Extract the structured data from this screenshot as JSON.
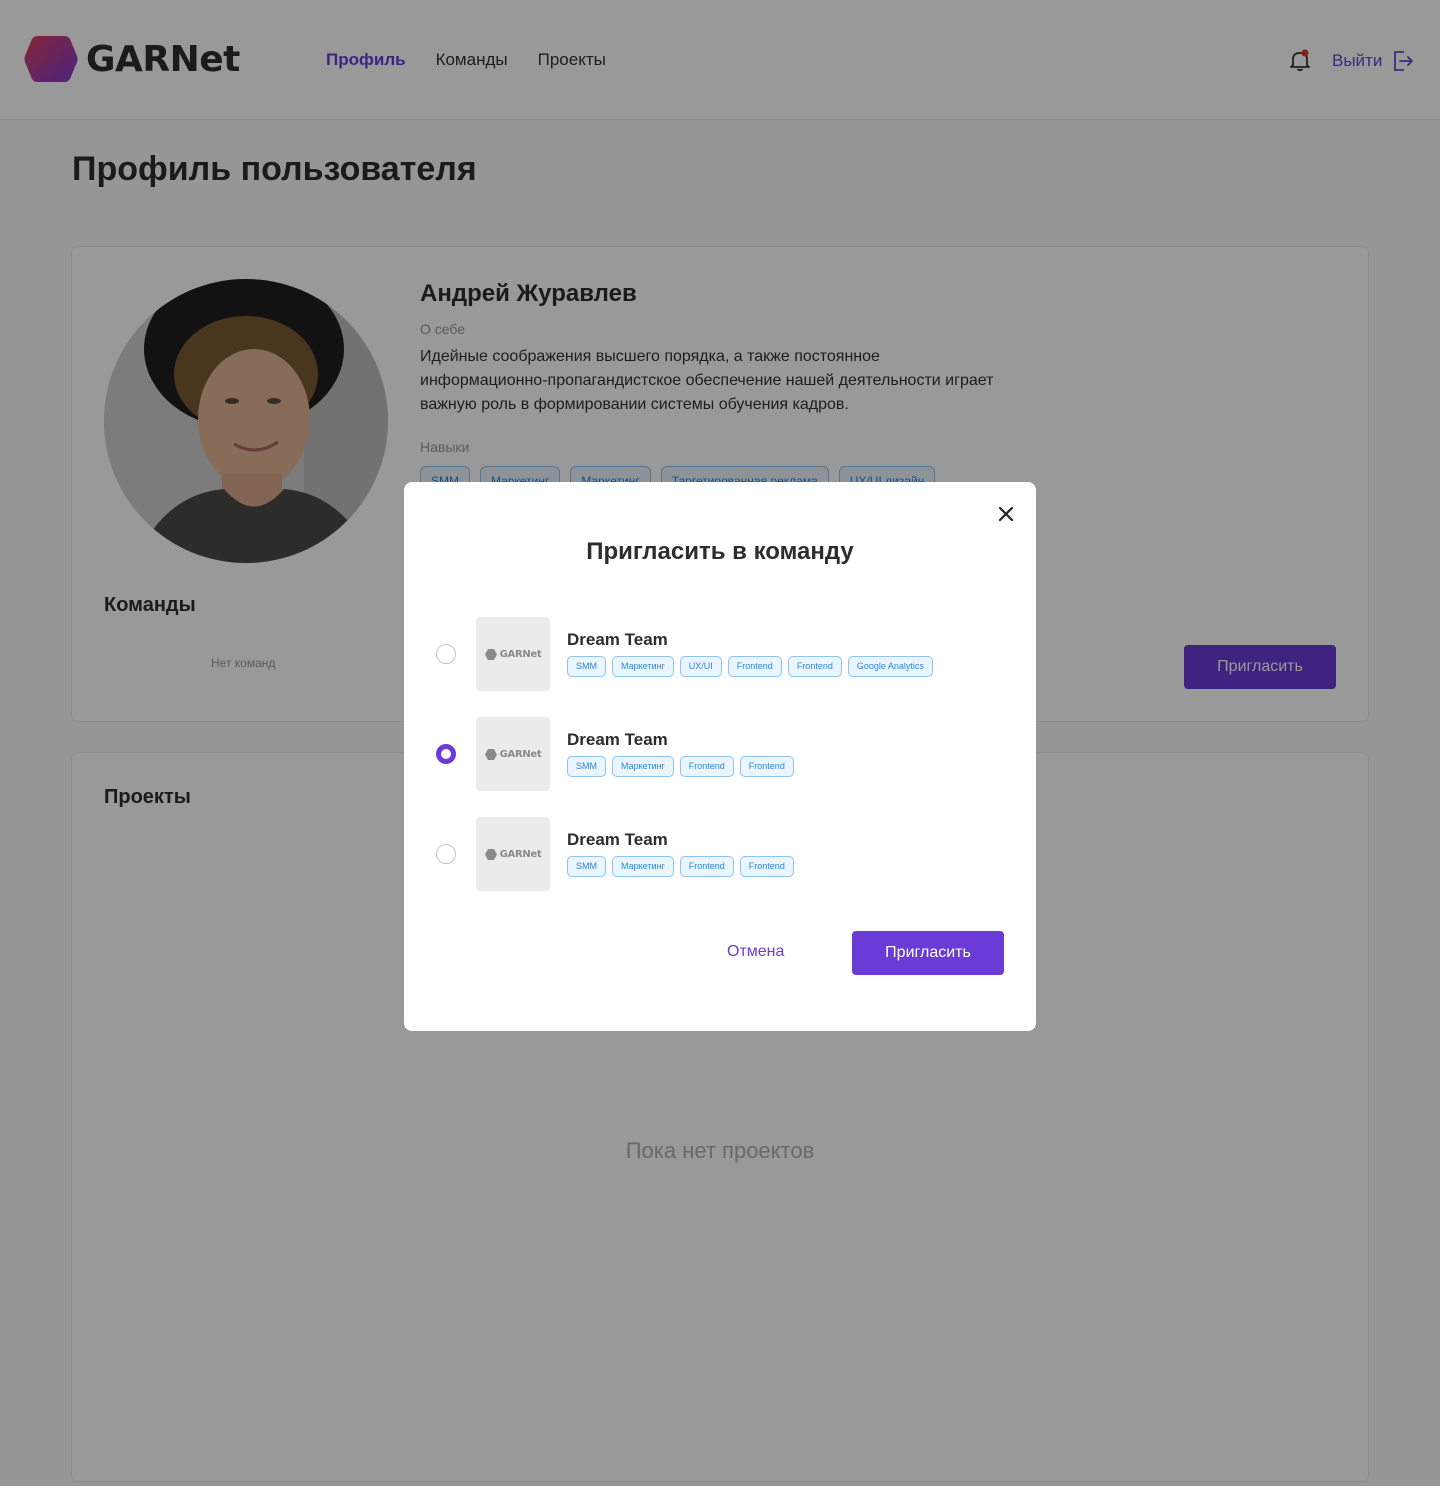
{
  "brand": {
    "name": "GARNet",
    "accent": "#6a3bd6",
    "logo_gradient": [
      "#d93b5c",
      "#8a3bd6"
    ]
  },
  "nav": {
    "items": [
      {
        "label": "Профиль",
        "active": true
      },
      {
        "label": "Команды",
        "active": false
      },
      {
        "label": "Проекты",
        "active": false
      }
    ],
    "logout_label": "Выйти",
    "notification_dot": true
  },
  "page": {
    "title": "Профиль пользователя"
  },
  "profile": {
    "name": "Андрей Журавлев",
    "about_label": "О себе",
    "about_text": "Идейные соображения высшего порядка, а также постоянное информационно-пропагандистское обеспечение нашей деятельности играет важную роль в формировании системы обучения кадров.",
    "skills_label": "Навыки",
    "skills": [
      "SMM",
      "Маркетинг",
      "Маркетинг",
      "Таргетированная реклама",
      "UX/UI дизайн"
    ],
    "teams_title": "Команды",
    "no_teams": "Нет команд",
    "invite_label": "Пригласить"
  },
  "projects": {
    "title": "Проекты",
    "empty": "Пока нет проектов"
  },
  "modal": {
    "title": "Пригласить в команду",
    "thumb_label": "GARNet",
    "teams": [
      {
        "name": "Dream Team",
        "selected": false,
        "tags": [
          "SMM",
          "Маркетинг",
          "UX/UI",
          "Frontend",
          "Frontend",
          "Google Analytics"
        ]
      },
      {
        "name": "Dream Team",
        "selected": true,
        "tags": [
          "SMM",
          "Маркетинг",
          "Frontend",
          "Frontend"
        ]
      },
      {
        "name": "Dream Team",
        "selected": false,
        "tags": [
          "SMM",
          "Маркетинг",
          "Frontend",
          "Frontend"
        ]
      }
    ],
    "cancel_label": "Отмена",
    "confirm_label": "Пригласить"
  }
}
